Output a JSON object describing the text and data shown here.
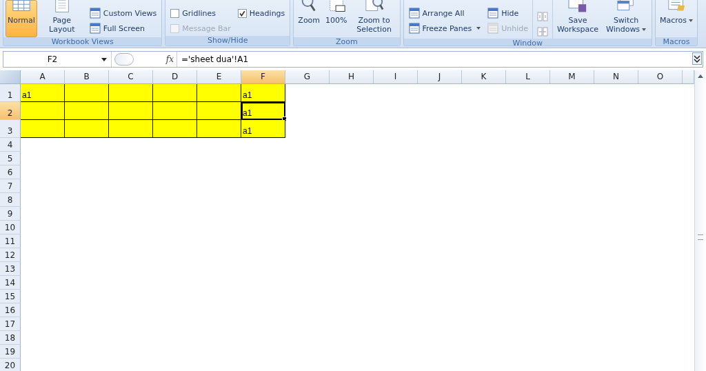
{
  "ribbon": {
    "groups": [
      {
        "label": "Workbook Views",
        "items": [
          {
            "kind": "large",
            "label": "Normal",
            "selected": true
          },
          {
            "kind": "large",
            "label": "Page Layout",
            "selected": false
          },
          {
            "kind": "stack",
            "items": [
              {
                "kind": "small",
                "label": "Custom Views",
                "disabled": false
              },
              {
                "kind": "small",
                "label": "Full Screen",
                "disabled": false
              }
            ]
          }
        ]
      },
      {
        "label": "Show/Hide",
        "items": [
          {
            "kind": "stack",
            "items": [
              {
                "kind": "check",
                "label": "Gridlines",
                "checked": false,
                "disabled": false
              },
              {
                "kind": "check",
                "label": "Message Bar",
                "checked": false,
                "disabled": true
              }
            ]
          },
          {
            "kind": "stack",
            "items": [
              {
                "kind": "check",
                "label": "Headings",
                "checked": true,
                "disabled": false
              }
            ]
          }
        ]
      },
      {
        "label": "Zoom",
        "items": [
          {
            "kind": "large",
            "label": "Zoom",
            "selected": false
          },
          {
            "kind": "large",
            "label": "100%",
            "selected": false
          },
          {
            "kind": "large",
            "label": "Zoom to Selection",
            "selected": false
          }
        ]
      },
      {
        "label": "Window",
        "items": [
          {
            "kind": "stack",
            "items": [
              {
                "kind": "small",
                "label": "Arrange All",
                "disabled": false
              },
              {
                "kind": "small",
                "label": "Freeze Panes",
                "disabled": false,
                "dropdown": true
              }
            ]
          },
          {
            "kind": "stack",
            "items": [
              {
                "kind": "small",
                "label": "Hide",
                "disabled": false
              },
              {
                "kind": "small",
                "label": "Unhide",
                "disabled": true
              }
            ]
          },
          {
            "kind": "iconstack"
          },
          {
            "kind": "large",
            "label": "Save Workspace",
            "selected": false
          },
          {
            "kind": "large",
            "label": "Switch Windows",
            "selected": false,
            "dropdown": true
          }
        ]
      },
      {
        "label": "Macros",
        "items": [
          {
            "kind": "large",
            "label": "Macros",
            "selected": false,
            "dropdown": true
          }
        ]
      }
    ]
  },
  "formula_bar": {
    "name_box": "F2",
    "function_label": "fx",
    "formula": "='sheet dua'!A1"
  },
  "sheet": {
    "columns": [
      {
        "label": "A",
        "selected": false
      },
      {
        "label": "B",
        "selected": false
      },
      {
        "label": "C",
        "selected": false
      },
      {
        "label": "D",
        "selected": false
      },
      {
        "label": "E",
        "selected": false
      },
      {
        "label": "F",
        "selected": true
      },
      {
        "label": "G",
        "selected": false
      },
      {
        "label": "H",
        "selected": false
      },
      {
        "label": "I",
        "selected": false
      },
      {
        "label": "J",
        "selected": false
      },
      {
        "label": "K",
        "selected": false
      },
      {
        "label": "L",
        "selected": false
      },
      {
        "label": "M",
        "selected": false
      },
      {
        "label": "N",
        "selected": false
      },
      {
        "label": "O",
        "selected": false
      }
    ],
    "rows": [
      {
        "label": "1",
        "selected": false,
        "tall": true,
        "cells": [
          {
            "text": "a1",
            "filled": true,
            "selected": false
          },
          {
            "filled": true,
            "selected": false
          },
          {
            "filled": true,
            "selected": false
          },
          {
            "filled": true,
            "selected": false
          },
          {
            "filled": true,
            "selected": false
          },
          {
            "text": "a1",
            "filled": true,
            "selected": false
          }
        ]
      },
      {
        "label": "2",
        "selected": true,
        "tall": true,
        "cells": [
          {
            "filled": true,
            "selected": false
          },
          {
            "filled": true,
            "selected": false
          },
          {
            "filled": true,
            "selected": false
          },
          {
            "filled": true,
            "selected": false
          },
          {
            "filled": true,
            "selected": false
          },
          {
            "text": "a1",
            "filled": true,
            "selected": true
          }
        ]
      },
      {
        "label": "3",
        "selected": false,
        "tall": true,
        "cells": [
          {
            "filled": true,
            "selected": false
          },
          {
            "filled": true,
            "selected": false
          },
          {
            "filled": true,
            "selected": false
          },
          {
            "filled": true,
            "selected": false
          },
          {
            "filled": true,
            "selected": false
          },
          {
            "text": "a1",
            "filled": true,
            "selected": false
          }
        ]
      },
      {
        "label": "4",
        "selected": false,
        "tall": false
      },
      {
        "label": "5",
        "selected": false,
        "tall": false
      },
      {
        "label": "6",
        "selected": false,
        "tall": false
      },
      {
        "label": "7",
        "selected": false,
        "tall": false
      },
      {
        "label": "8",
        "selected": false,
        "tall": false
      },
      {
        "label": "9",
        "selected": false,
        "tall": false
      },
      {
        "label": "10",
        "selected": false,
        "tall": false
      },
      {
        "label": "11",
        "selected": false,
        "tall": false
      },
      {
        "label": "12",
        "selected": false,
        "tall": false
      },
      {
        "label": "13",
        "selected": false,
        "tall": false
      },
      {
        "label": "14",
        "selected": false,
        "tall": false
      },
      {
        "label": "15",
        "selected": false,
        "tall": false
      },
      {
        "label": "16",
        "selected": false,
        "tall": false
      },
      {
        "label": "17",
        "selected": false,
        "tall": false
      },
      {
        "label": "18",
        "selected": false,
        "tall": false
      },
      {
        "label": "19",
        "selected": false,
        "tall": false
      },
      {
        "label": "20",
        "selected": false,
        "tall": false
      }
    ]
  }
}
